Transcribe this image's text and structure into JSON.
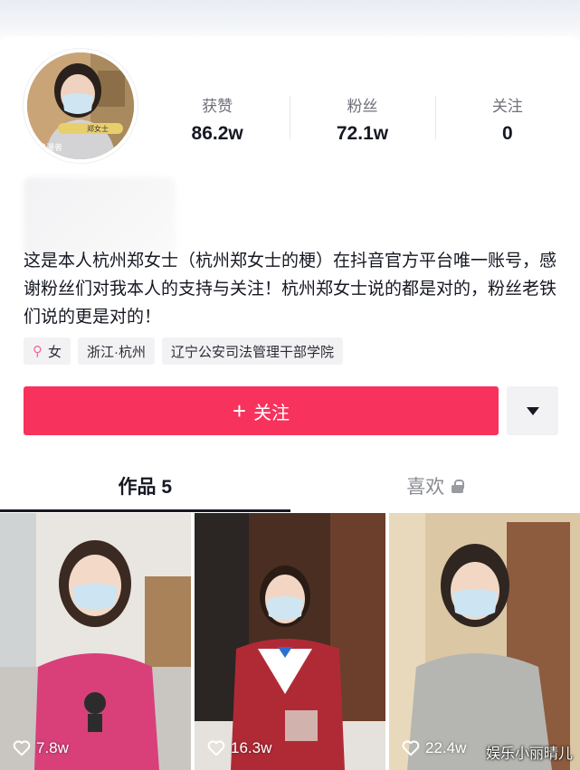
{
  "profile": {
    "avatar_badge": "郑女士",
    "avatar_caption": "浪漫者"
  },
  "stats": [
    {
      "label": "获赞",
      "value": "86.2w"
    },
    {
      "label": "粉丝",
      "value": "72.1w"
    },
    {
      "label": "关注",
      "value": "0"
    }
  ],
  "bio": "这是本人杭州郑女士（杭州郑女士的梗）在抖音官方平台唯一账号，感谢粉丝们对我本人的支持与关注！杭州郑女士说的都是对的，粉丝老铁们说的更是对的！",
  "tags": {
    "gender_icon": "female-icon",
    "gender": "女",
    "location": "浙江·杭州",
    "school": "辽宁公安司法管理干部学院"
  },
  "actions": {
    "follow_plus": "+",
    "follow_label": "关注",
    "accent": "#f7325c"
  },
  "tabs": [
    {
      "label": "作品 5",
      "active": true
    },
    {
      "label": "喜欢",
      "locked": true
    }
  ],
  "videos": [
    {
      "likes": "7.8w",
      "shirt": "#d9407a"
    },
    {
      "likes": "16.3w",
      "shirt": "#b02a36"
    },
    {
      "likes": "22.4w",
      "shirt": "#b5b6b1"
    }
  ],
  "watermark": "娱乐小丽晴儿"
}
